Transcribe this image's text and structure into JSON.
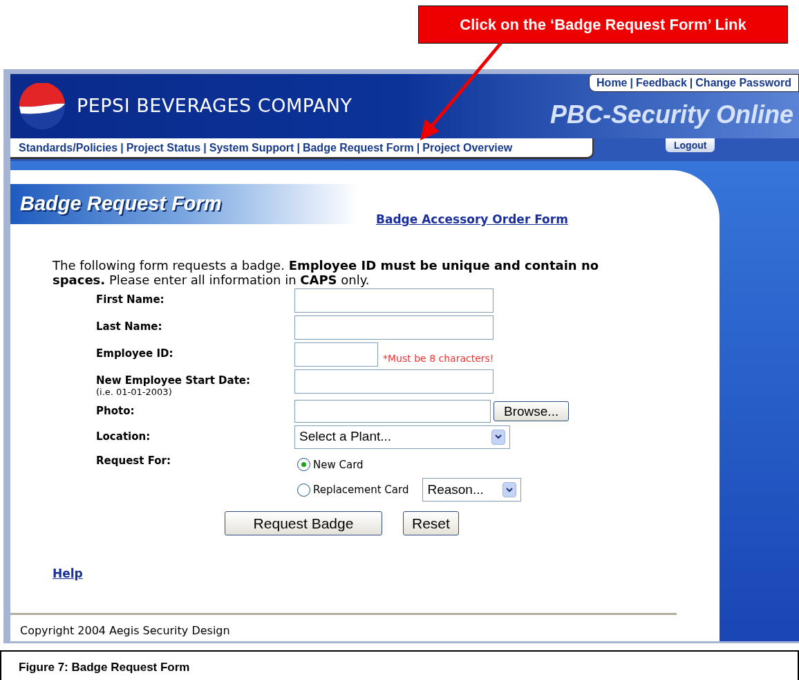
{
  "callout": {
    "text": "Click on the ‘Badge Request Form’ Link"
  },
  "header": {
    "company": "PEPSI BEVERAGES COMPANY",
    "app_title": "PBC-Security Online",
    "top_links": [
      "Home",
      "Feedback",
      "Change Password"
    ],
    "nav_links": [
      "Standards/Policies",
      "Project Status",
      "System Support",
      "Badge Request Form",
      "Project Overview"
    ],
    "logout": "Logout",
    "separator": "|"
  },
  "page_title": "Badge Request Form",
  "accessory_link": "Badge Accessory Order Form",
  "intro": "The following form requests a badge. **Employee ID must be unique and contain no spaces.**  Please enter all information in **CAPS** only.",
  "fields": [
    {
      "kind": "text",
      "label": "First Name:"
    },
    {
      "kind": "text",
      "label": "Last Name:"
    },
    {
      "kind": "short",
      "label": "Employee ID:",
      "note": "*Must be 8 characters!"
    },
    {
      "kind": "text",
      "label": "New Employee Start Date:",
      "hint": "(i.e. 01-01-2003)"
    },
    {
      "kind": "file",
      "label": "Photo:",
      "button": "Browse..."
    },
    {
      "kind": "select",
      "label": "Location:",
      "value": "Select a Plant..."
    }
  ],
  "request_for": {
    "label": "Request For:",
    "options": [
      {
        "label": "New Card",
        "selected": true
      },
      {
        "label": "Replacement Card",
        "selected": false,
        "select": "Reason..."
      }
    ]
  },
  "buttons": [
    "Request Badge",
    "Reset"
  ],
  "help": "Help",
  "copyright": "Copyright 2004 Aegis Security Design",
  "caption": "Figure 7: Badge Request Form"
}
